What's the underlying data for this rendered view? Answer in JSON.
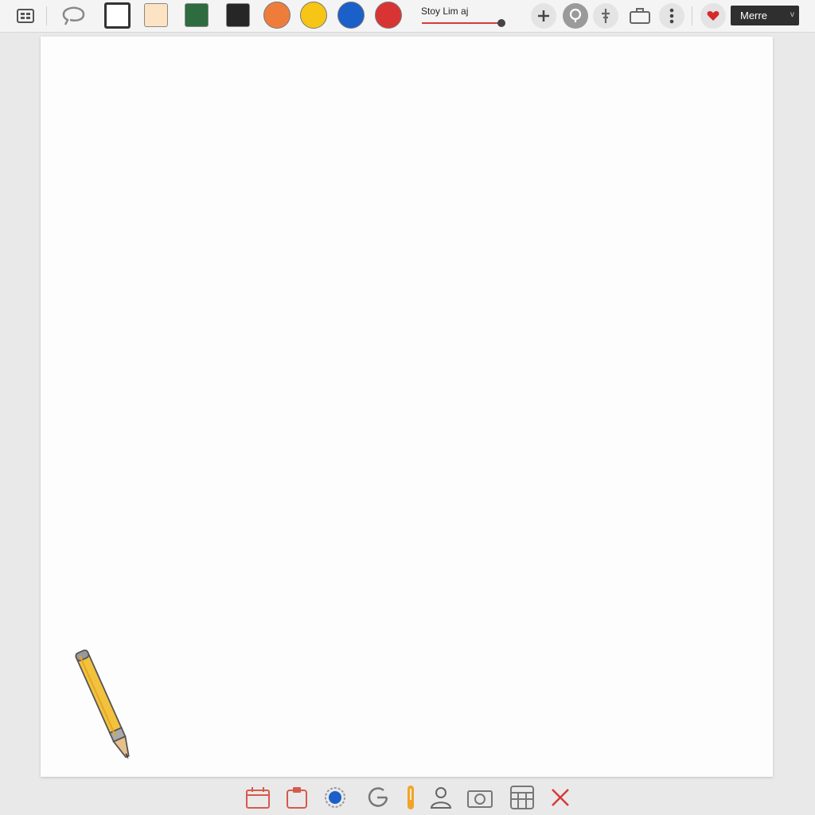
{
  "toolbar": {
    "brush_slider": {
      "label": "Stoy Lim aj",
      "value": 0.95
    },
    "menu": {
      "value": "Merre",
      "caret": "v"
    },
    "swatches": {
      "white_square": "#ffffff",
      "cream_square": "#fbe3c3",
      "green_square": "#2e6b3e",
      "black_square": "#262626",
      "orange_circle": "#ee7d3c",
      "yellow_circle": "#f6c515",
      "blue_circle": "#1b5fc9",
      "red_circle": "#d93434"
    },
    "icons": [
      "grid-icon",
      "lasso-icon",
      "plus-icon",
      "lightbulb-icon",
      "pin-icon",
      "briefcase-icon",
      "more-vertical-icon",
      "heart-icon"
    ]
  },
  "canvas": {
    "background": "#fdfdfd",
    "tool": "pencil-icon"
  },
  "bottom_toolbar": {
    "icons": [
      "calendar-icon",
      "clipboard-icon",
      "record-icon",
      "redo-icon",
      "marker-icon",
      "user-icon",
      "camera-icon",
      "grid-table-icon",
      "close-icon"
    ]
  },
  "colors": {
    "accent": "#d23b3b",
    "heart": "#d42a2a",
    "close": "#d53a3a"
  }
}
